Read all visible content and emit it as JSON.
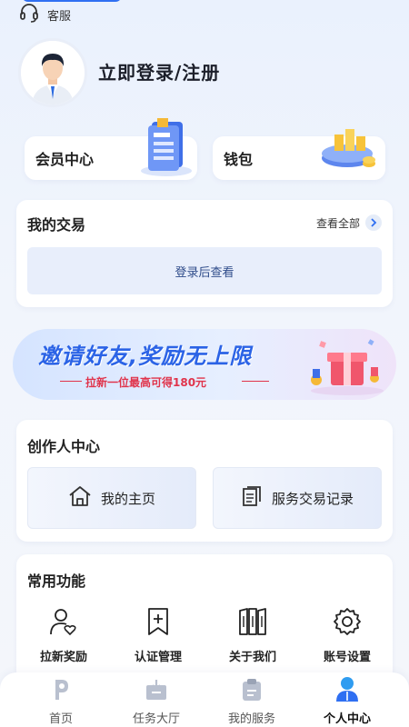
{
  "header": {
    "service_label": "客服"
  },
  "profile": {
    "login_label": "立即登录/注册"
  },
  "quick_cards": {
    "member_label": "会员中心",
    "wallet_label": "钱包"
  },
  "transactions": {
    "title": "我的交易",
    "view_all_label": "查看全部",
    "login_hint": "登录后查看"
  },
  "banner": {
    "title": "邀请好友,奖励无上限",
    "subtitle": "拉新一位最高可得180元"
  },
  "creator": {
    "title": "创作人中心",
    "homepage_label": "我的主页",
    "records_label": "服务交易记录"
  },
  "functions": {
    "title": "常用功能",
    "items": [
      {
        "label": "拉新奖励",
        "icon": "user-heart-icon"
      },
      {
        "label": "认证管理",
        "icon": "bookmark-plus-icon"
      },
      {
        "label": "关于我们",
        "icon": "book-icon"
      },
      {
        "label": "账号设置",
        "icon": "gear-icon"
      }
    ]
  },
  "tabbar": {
    "items": [
      {
        "label": "首页",
        "icon": "home-logo-icon"
      },
      {
        "label": "任务大厅",
        "icon": "task-box-icon"
      },
      {
        "label": "我的服务",
        "icon": "clipboard-icon"
      },
      {
        "label": "个人中心",
        "icon": "person-icon",
        "active": true
      }
    ]
  },
  "colors": {
    "accent": "#2f6ff2",
    "banner_red": "#e0334b",
    "background": "#eef3fc"
  }
}
